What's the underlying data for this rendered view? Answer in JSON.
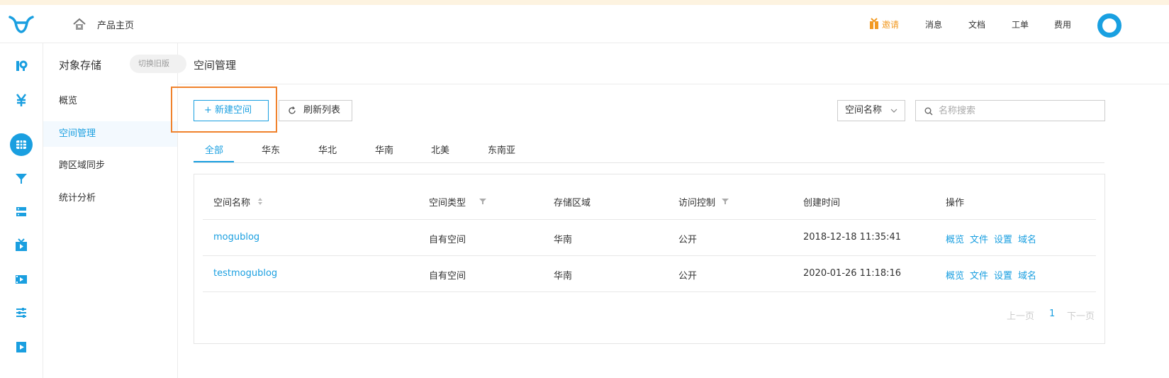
{
  "header": {
    "home_label": "产品主页",
    "invite": "邀请",
    "messages": "消息",
    "docs": "文档",
    "tickets": "工单",
    "billing": "费用"
  },
  "subnav": {
    "title": "对象存储",
    "switch_label": "切换旧版",
    "items": [
      "概览",
      "空间管理",
      "跨区域同步",
      "统计分析"
    ]
  },
  "main": {
    "title": "空间管理",
    "new_button": "+ 新建空间",
    "refresh_button": "刷新列表",
    "filter_select": "空间名称",
    "search_placeholder": "名称搜索",
    "tabs": [
      "全部",
      "华东",
      "华北",
      "华南",
      "北美",
      "东南亚"
    ]
  },
  "table": {
    "headers": [
      "空间名称",
      "空间类型",
      "存储区域",
      "访问控制",
      "创建时间",
      "操作"
    ],
    "rows": [
      {
        "name": "mogublog",
        "type": "自有空间",
        "region": "华南",
        "access": "公开",
        "created": "2018-12-18 11:35:41"
      },
      {
        "name": "testmogublog",
        "type": "自有空间",
        "region": "华南",
        "access": "公开",
        "created": "2020-01-26 11:18:16"
      }
    ],
    "actions": [
      "概览",
      "文件",
      "设置",
      "域名"
    ]
  },
  "pager": {
    "prev": "上一页",
    "current": "1",
    "next": "下一页"
  },
  "colors": {
    "accent": "#1a9fe0",
    "invite": "#f29a22",
    "highlight": "#f0822c"
  }
}
